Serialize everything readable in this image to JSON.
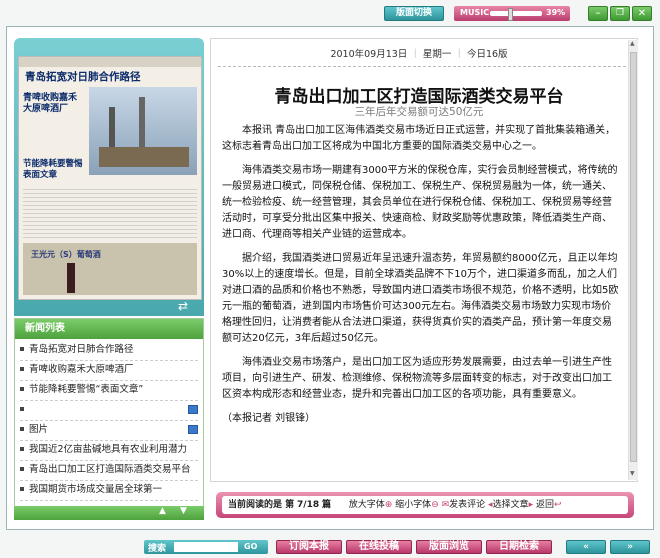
{
  "topbar": {
    "switch_label": "版面切换",
    "music_label": "MUSIC",
    "volume_percent": "39%"
  },
  "article": {
    "date": "2010年09月13日",
    "weekday": "星期一",
    "today_pages": "今日16版",
    "title": "青岛出口加工区打造国际酒类交易平台",
    "subtitle": "三年后年交易额可达50亿元",
    "paragraphs": [
      "本报讯  青岛出口加工区海伟酒类交易市场近日正式运营，并实现了首批集装箱通关，这标志着青岛出口加工区将成为中国北方重要的国际酒类交易中心之一。",
      "海伟酒类交易市场一期建有3000平方米的保税仓库，实行会员制经营模式，将传统的一般贸易进口模式，同保税仓储、保税加工、保税生产、保税贸易融为一体，统一通关、统一检验检疫、统一经营管理，其会员单位在进行保税仓储、保税加工、保税贸易等经营活动时，可享受分批出区集中报关、快速商检、财政奖励等优惠政策，降低酒类生产商、进口商、代理商等相关产业链的运营成本。",
      "据介绍，我国酒类进口贸易近年呈迅速升温态势，年贸易额约8000亿元，且正以年均30%以上的速度增长。但是，目前全球酒类品牌不下10万个，进口渠道多而乱，加之人们对进口酒的品质和价格也不熟悉，导致国内进口酒类市场很不规范，价格不透明，比如5欧元一瓶的葡萄酒，进到国内市场售价可达300元左右。海伟酒类交易市场致力实现市场价格理性回归，让消费者能从合法进口渠道，获得货真价实的酒类产品，预计第一年度交易额可达20亿元，3年后超过50亿元。",
      "海伟酒业交易市场落户，是出口加工区为适应形势发展需要，由过去单一引进生产性项目，向引进生产、研发、检测维修、保税物流等多层面转变的标志，对于改变出口加工区资本构成形态和经营业态，提升和完善出口加工区的各项功能，具有重要意义。"
    ],
    "byline": "（本报记者  刘银锋）"
  },
  "newspaper_preview": {
    "masthead": "青岛拓宽对日肺合作路径",
    "headline_1": "青啤收购嘉禾大原啤酒厂",
    "headline_2": "节能降耗要警惕表面文章",
    "ad_text": "王光元（S）葡萄酒"
  },
  "news_list": {
    "title": "新闻列表",
    "items": [
      {
        "text": "青岛拓宽对日肺合作路径",
        "icon": false
      },
      {
        "text": "青啤收购嘉禾大原啤酒厂",
        "icon": false
      },
      {
        "text": "节能降耗要警惕“表面文章”",
        "icon": false
      },
      {
        "text": "",
        "icon": true
      },
      {
        "text": "图片",
        "icon": true
      },
      {
        "text": "我国近2亿亩盐碱地具有农业利用潜力",
        "icon": false
      },
      {
        "text": "青岛出口加工区打造国际酒类交易平台",
        "icon": false
      },
      {
        "text": "我国期货市场成交量居全球第一",
        "icon": false
      }
    ]
  },
  "reading_bar": {
    "current_label": "当前阅读的是 第",
    "current_page": "7/18",
    "page_suffix": "篇",
    "enlarge": "放大字体",
    "shrink": "缩小字体",
    "comment": "发表评论",
    "select": "选择文章",
    "back": "返回"
  },
  "bottom": {
    "search_label": "搜索",
    "go_label": "GO",
    "subscribe": "订阅本报",
    "submit": "在线投稿",
    "browse": "版面浏览",
    "search_date": "日期检索"
  }
}
